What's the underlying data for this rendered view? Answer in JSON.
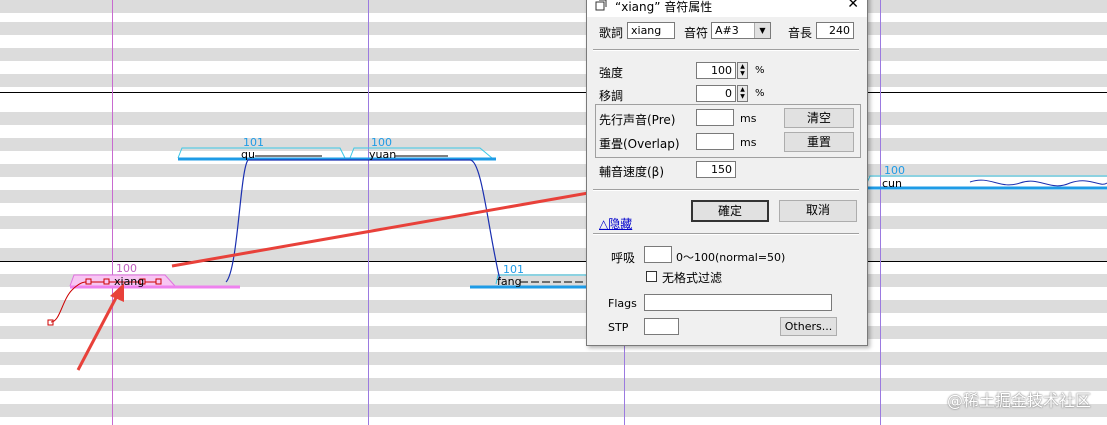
{
  "piano_roll": {
    "notes": [
      {
        "velocity": "100",
        "lyric": "xiang"
      },
      {
        "velocity": "101",
        "lyric": "qu"
      },
      {
        "velocity": "100",
        "lyric": "yuan"
      },
      {
        "velocity": "101",
        "lyric": "fang"
      },
      {
        "velocity": "100",
        "lyric": "cun"
      }
    ]
  },
  "dialog": {
    "title": "“xiang” 音符属性",
    "close_icon": "close-icon",
    "lyric_label": "歌詞",
    "lyric_value": "xiang",
    "note_label": "音符",
    "note_value": "A#3",
    "length_label": "音長",
    "length_value": "240",
    "intensity_label": "強度",
    "intensity_value": "100",
    "intensity_unit": "%",
    "modulation_label": "移調",
    "modulation_value": "0",
    "modulation_unit": "%",
    "preutterance_label": "先行声音(Pre)",
    "preutterance_unit": "ms",
    "clear_button": "清空",
    "overlap_label": "重畳(Overlap)",
    "overlap_unit": "ms",
    "reset_button": "重置",
    "consonant_label": "輔音速度(β)",
    "consonant_value": "150",
    "hide_link": "△隐藏",
    "ok_button": "確定",
    "cancel_button": "取消",
    "breath_label": "呼吸",
    "breath_hint": "0～100(normal=50)",
    "no_format_filter_label": "无格式过滤",
    "flags_label": "Flags",
    "stp_label": "STP",
    "others_button": "Others..."
  },
  "watermark": "@稀土掘金技术社区",
  "colors": {
    "note_cyan": "#1e9be6",
    "note_magenta": "#ee82ee",
    "grid_purple": "#9b59d0",
    "arrow_red": "#e8413a",
    "pitch_blue": "#1a2fb0"
  }
}
